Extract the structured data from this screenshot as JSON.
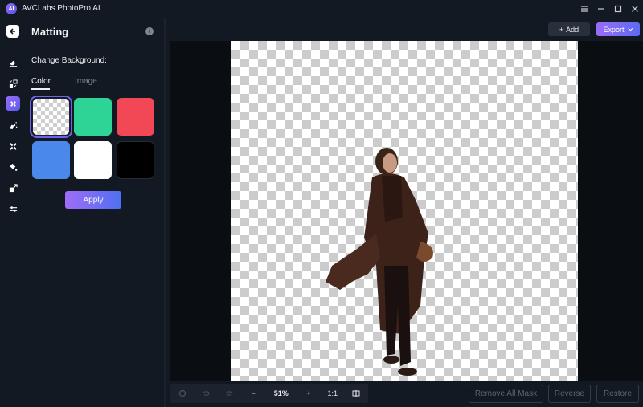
{
  "app": {
    "title": "AVCLabs PhotoPro AI",
    "logo_text": "AI"
  },
  "window_controls": [
    {
      "name": "menu-icon"
    },
    {
      "name": "minimize-icon"
    },
    {
      "name": "maximize-icon"
    },
    {
      "name": "close-icon"
    }
  ],
  "rail": {
    "back_icon": "arrow-left-icon",
    "items": [
      {
        "name": "eraser-icon",
        "label": "Object Remover",
        "active": false
      },
      {
        "name": "replace-icon",
        "label": "Replace",
        "active": false
      },
      {
        "name": "matting-icon",
        "label": "Matting",
        "active": true
      },
      {
        "name": "colorize-icon",
        "label": "Colorize",
        "active": false
      },
      {
        "name": "enhance-icon",
        "label": "Enhance",
        "active": false
      },
      {
        "name": "color-fill-icon",
        "label": "Color Fill",
        "active": false
      },
      {
        "name": "upscale-icon",
        "label": "Upscale",
        "active": false
      },
      {
        "name": "adjust-icon",
        "label": "Adjust",
        "active": false
      }
    ]
  },
  "panel": {
    "title": "Matting",
    "info_icon": "info-icon",
    "section_label": "Change Background:",
    "tabs": [
      {
        "label": "Color",
        "active": true
      },
      {
        "label": "Image",
        "active": false
      }
    ],
    "swatches": [
      {
        "name": "transparent",
        "color": "transparent",
        "selected": true
      },
      {
        "name": "green",
        "color": "#2ed496",
        "selected": false
      },
      {
        "name": "red",
        "color": "#f24754",
        "selected": false
      },
      {
        "name": "blue",
        "color": "#4a88ec",
        "selected": false
      },
      {
        "name": "white",
        "color": "#ffffff",
        "selected": false
      },
      {
        "name": "black",
        "color": "#000000",
        "selected": false
      }
    ],
    "apply_label": "Apply"
  },
  "toolbar": {
    "add_label": "Add",
    "add_icon": "plus-icon",
    "export_label": "Export",
    "export_icon": "chevron-down-icon"
  },
  "zoom_bar": {
    "reset_icon": "reset-icon",
    "undo_icon": "undo-icon",
    "redo_icon": "redo-icon",
    "zoom_out": "−",
    "zoom_value": "51%",
    "zoom_in": "+",
    "actual_size": "1:1",
    "compare_icon": "compare-icon"
  },
  "mask_actions": {
    "remove_all": "Remove All Mask",
    "reverse": "Reverse",
    "restore": "Restore"
  },
  "colors": {
    "accent_start": "#9a6cf7",
    "accent_end": "#4e70f2",
    "background": "#131922",
    "stage": "#0a0d12"
  }
}
